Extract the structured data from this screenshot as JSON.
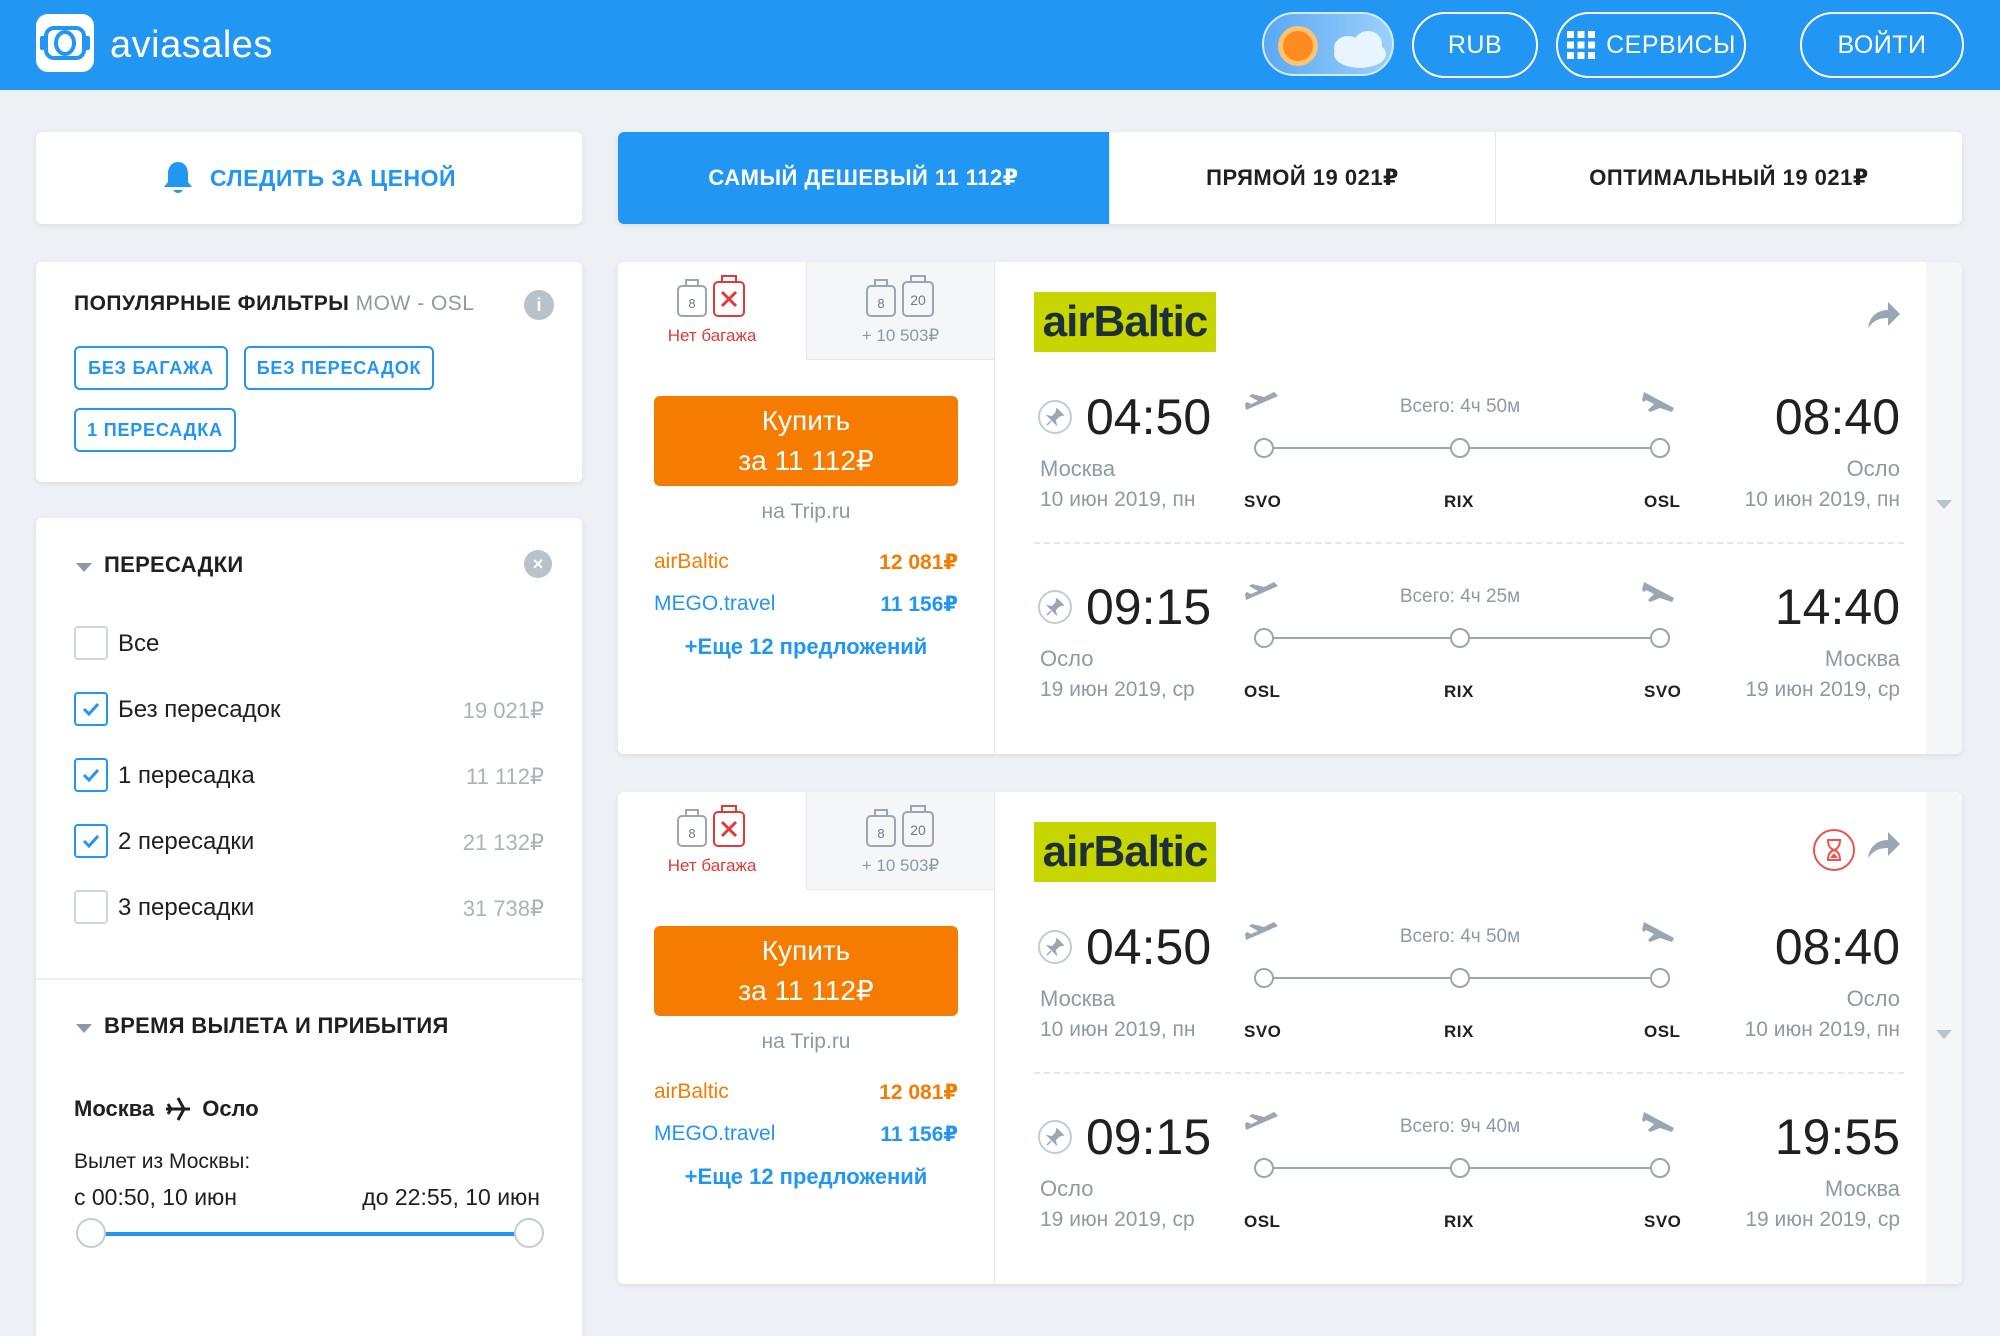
{
  "header": {
    "logo_text": "aviasales",
    "currency_label": "RUB",
    "services_label": "СЕРВИСЫ",
    "login_label": "ВОЙТИ"
  },
  "follow_price": {
    "label": "СЛЕДИТЬ ЗА ЦЕНОЙ",
    "icon": "bell-icon"
  },
  "sort_tabs": [
    {
      "label": "САМЫЙ ДЕШЕВЫЙ",
      "price": "11 112₽",
      "active": true
    },
    {
      "label": "ПРЯМОЙ",
      "price": "19 021₽",
      "active": false
    },
    {
      "label": "ОПТИМАЛЬНЫЙ",
      "price": "19 021₽",
      "active": false
    }
  ],
  "popular_filters": {
    "title": "ПОПУЛЯРНЫЕ ФИЛЬТРЫ",
    "route": "MOW - OSL",
    "info_icon": "info-icon",
    "chips": [
      "БЕЗ БАГАЖА",
      "БЕЗ ПЕРЕСАДОК",
      "1 ПЕРЕСАДКА"
    ]
  },
  "stops_filter": {
    "title": "ПЕРЕСАДКИ",
    "options": [
      {
        "label": "Все",
        "price": "",
        "checked": false
      },
      {
        "label": "Без пересадок",
        "price": "19 021₽",
        "checked": true
      },
      {
        "label": "1 пересадка",
        "price": "11 112₽",
        "checked": true
      },
      {
        "label": "2 пересадки",
        "price": "21 132₽",
        "checked": true
      },
      {
        "label": "3 пересадки",
        "price": "31 738₽",
        "checked": false
      }
    ]
  },
  "time_filter": {
    "title": "ВРЕМЯ ВЫЛЕТА И ПРИБЫТИЯ",
    "from_city": "Москва",
    "to_city": "Осло",
    "departure_label": "Вылет из Москвы:",
    "range_from": "с 00:50, 10 июн",
    "range_to": "до 22:55, 10 июн"
  },
  "tickets": [
    {
      "baggage_tabs": [
        {
          "note": "Нет багажа",
          "carry_on": "8",
          "checked": ""
        },
        {
          "note": "+ 10 503₽",
          "carry_on": "8",
          "checked": "20"
        }
      ],
      "buy_line1": "Купить",
      "buy_line2": "за 11 112₽",
      "agent": "на Trip.ru",
      "offers": [
        {
          "name": "airBaltic",
          "price": "12 081₽",
          "color": "#f57c00"
        },
        {
          "name": "MEGO.travel",
          "price": "11 156₽",
          "color": "#2196f3"
        }
      ],
      "more_offers": "+Еще 12 предложений",
      "airline_logo": "airBaltic",
      "show_timer": false,
      "segments": [
        {
          "dep_time": "04:50",
          "dep_city": "Москва",
          "dep_date": "10 июн 2019, пн",
          "total": "Всего: 4ч 50м",
          "iata": [
            "SVO",
            "RIX",
            "OSL"
          ],
          "arr_time": "08:40",
          "arr_city": "Осло",
          "arr_date": "10 июн 2019, пн"
        },
        {
          "dep_time": "09:15",
          "dep_city": "Осло",
          "dep_date": "19 июн 2019, ср",
          "total": "Всего: 4ч 25м",
          "iata": [
            "OSL",
            "RIX",
            "SVO"
          ],
          "arr_time": "14:40",
          "arr_city": "Москва",
          "arr_date": "19 июн 2019, ср"
        }
      ]
    },
    {
      "baggage_tabs": [
        {
          "note": "Нет багажа",
          "carry_on": "8",
          "checked": ""
        },
        {
          "note": "+ 10 503₽",
          "carry_on": "8",
          "checked": "20"
        }
      ],
      "buy_line1": "Купить",
      "buy_line2": "за 11 112₽",
      "agent": "на Trip.ru",
      "offers": [
        {
          "name": "airBaltic",
          "price": "12 081₽",
          "color": "#f57c00"
        },
        {
          "name": "MEGO.travel",
          "price": "11 156₽",
          "color": "#2196f3"
        }
      ],
      "more_offers": "+Еще 12 предложений",
      "airline_logo": "airBaltic",
      "show_timer": true,
      "segments": [
        {
          "dep_time": "04:50",
          "dep_city": "Москва",
          "dep_date": "10 июн 2019, пн",
          "total": "Всего: 4ч 50м",
          "iata": [
            "SVO",
            "RIX",
            "OSL"
          ],
          "arr_time": "08:40",
          "arr_city": "Осло",
          "arr_date": "10 июн 2019, пн"
        },
        {
          "dep_time": "09:15",
          "dep_city": "Осло",
          "dep_date": "19 июн 2019, ср",
          "total": "Всего: 9ч 40м",
          "iata": [
            "OSL",
            "RIX",
            "SVO"
          ],
          "arr_time": "19:55",
          "arr_city": "Москва",
          "arr_date": "19 июн 2019, ср"
        }
      ]
    }
  ],
  "colors": {
    "brand_blue": "#2196f3",
    "buy_orange": "#f57c00",
    "airline_green": "#c8d600",
    "no_baggage_red": "#e53935"
  }
}
